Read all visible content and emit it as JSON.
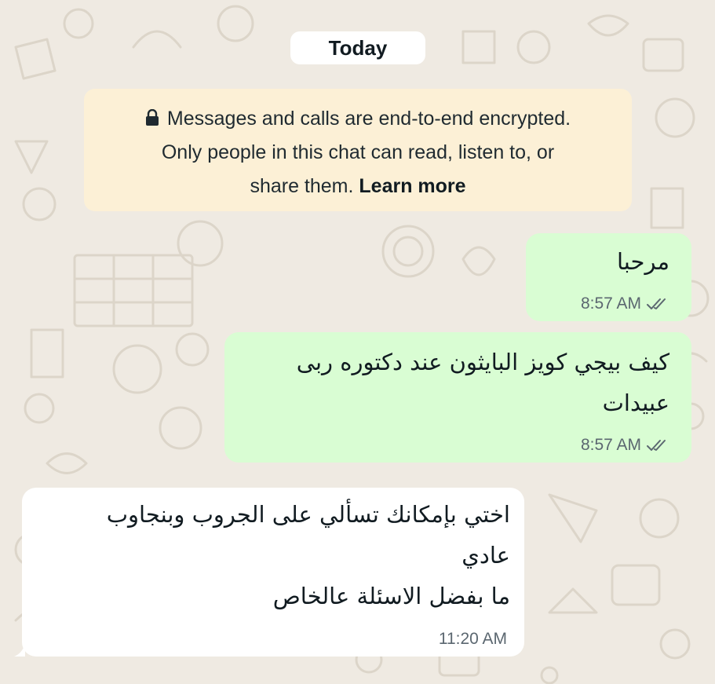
{
  "chat": {
    "date_separator": "Today",
    "encryption_notice": {
      "line1": "Messages and calls are end-to-end encrypted.",
      "line2": "Only people in this chat can read, listen to, or",
      "line3_prefix": "share them. ",
      "learn_more": "Learn more",
      "icon": "lock-icon"
    },
    "messages": [
      {
        "direction": "outgoing",
        "text": "مرحبا",
        "time": "8:57 AM",
        "status": "read",
        "status_icon": "double-check-icon"
      },
      {
        "direction": "outgoing",
        "text": "كيف بيجي كويز البايثون عند دكتوره ربى\nعبيدات",
        "time": "8:57 AM",
        "status": "read",
        "status_icon": "double-check-icon"
      },
      {
        "direction": "incoming",
        "text": "اختي بإمكانك تسألي على الجروب وبنجاوب\nعادي\nما بفضل الاسئلة عالخاص",
        "time": "11:20 AM"
      }
    ]
  },
  "colors": {
    "wallpaper": "#efeae2",
    "outgoing_bubble": "#d9fdd3",
    "incoming_bubble": "#ffffff",
    "notice_bg": "#fcf0d6",
    "meta_text": "#5b6770"
  }
}
